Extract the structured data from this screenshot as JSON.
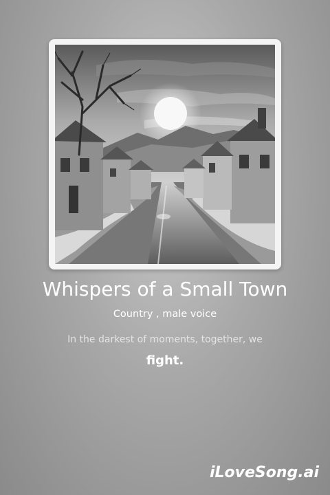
{
  "song": {
    "title": "Whispers of a Small Town",
    "style": "Country , male voice"
  },
  "lyrics": {
    "line_1": "In the darkest of moments, together, we",
    "line_2": "fight."
  },
  "brand": {
    "name": "iLoveSong.ai"
  },
  "cover": {
    "image_description_icon": "village-street-night-illustration"
  },
  "colors": {
    "text": "#ffffff",
    "frame": "#f4f4f4"
  }
}
